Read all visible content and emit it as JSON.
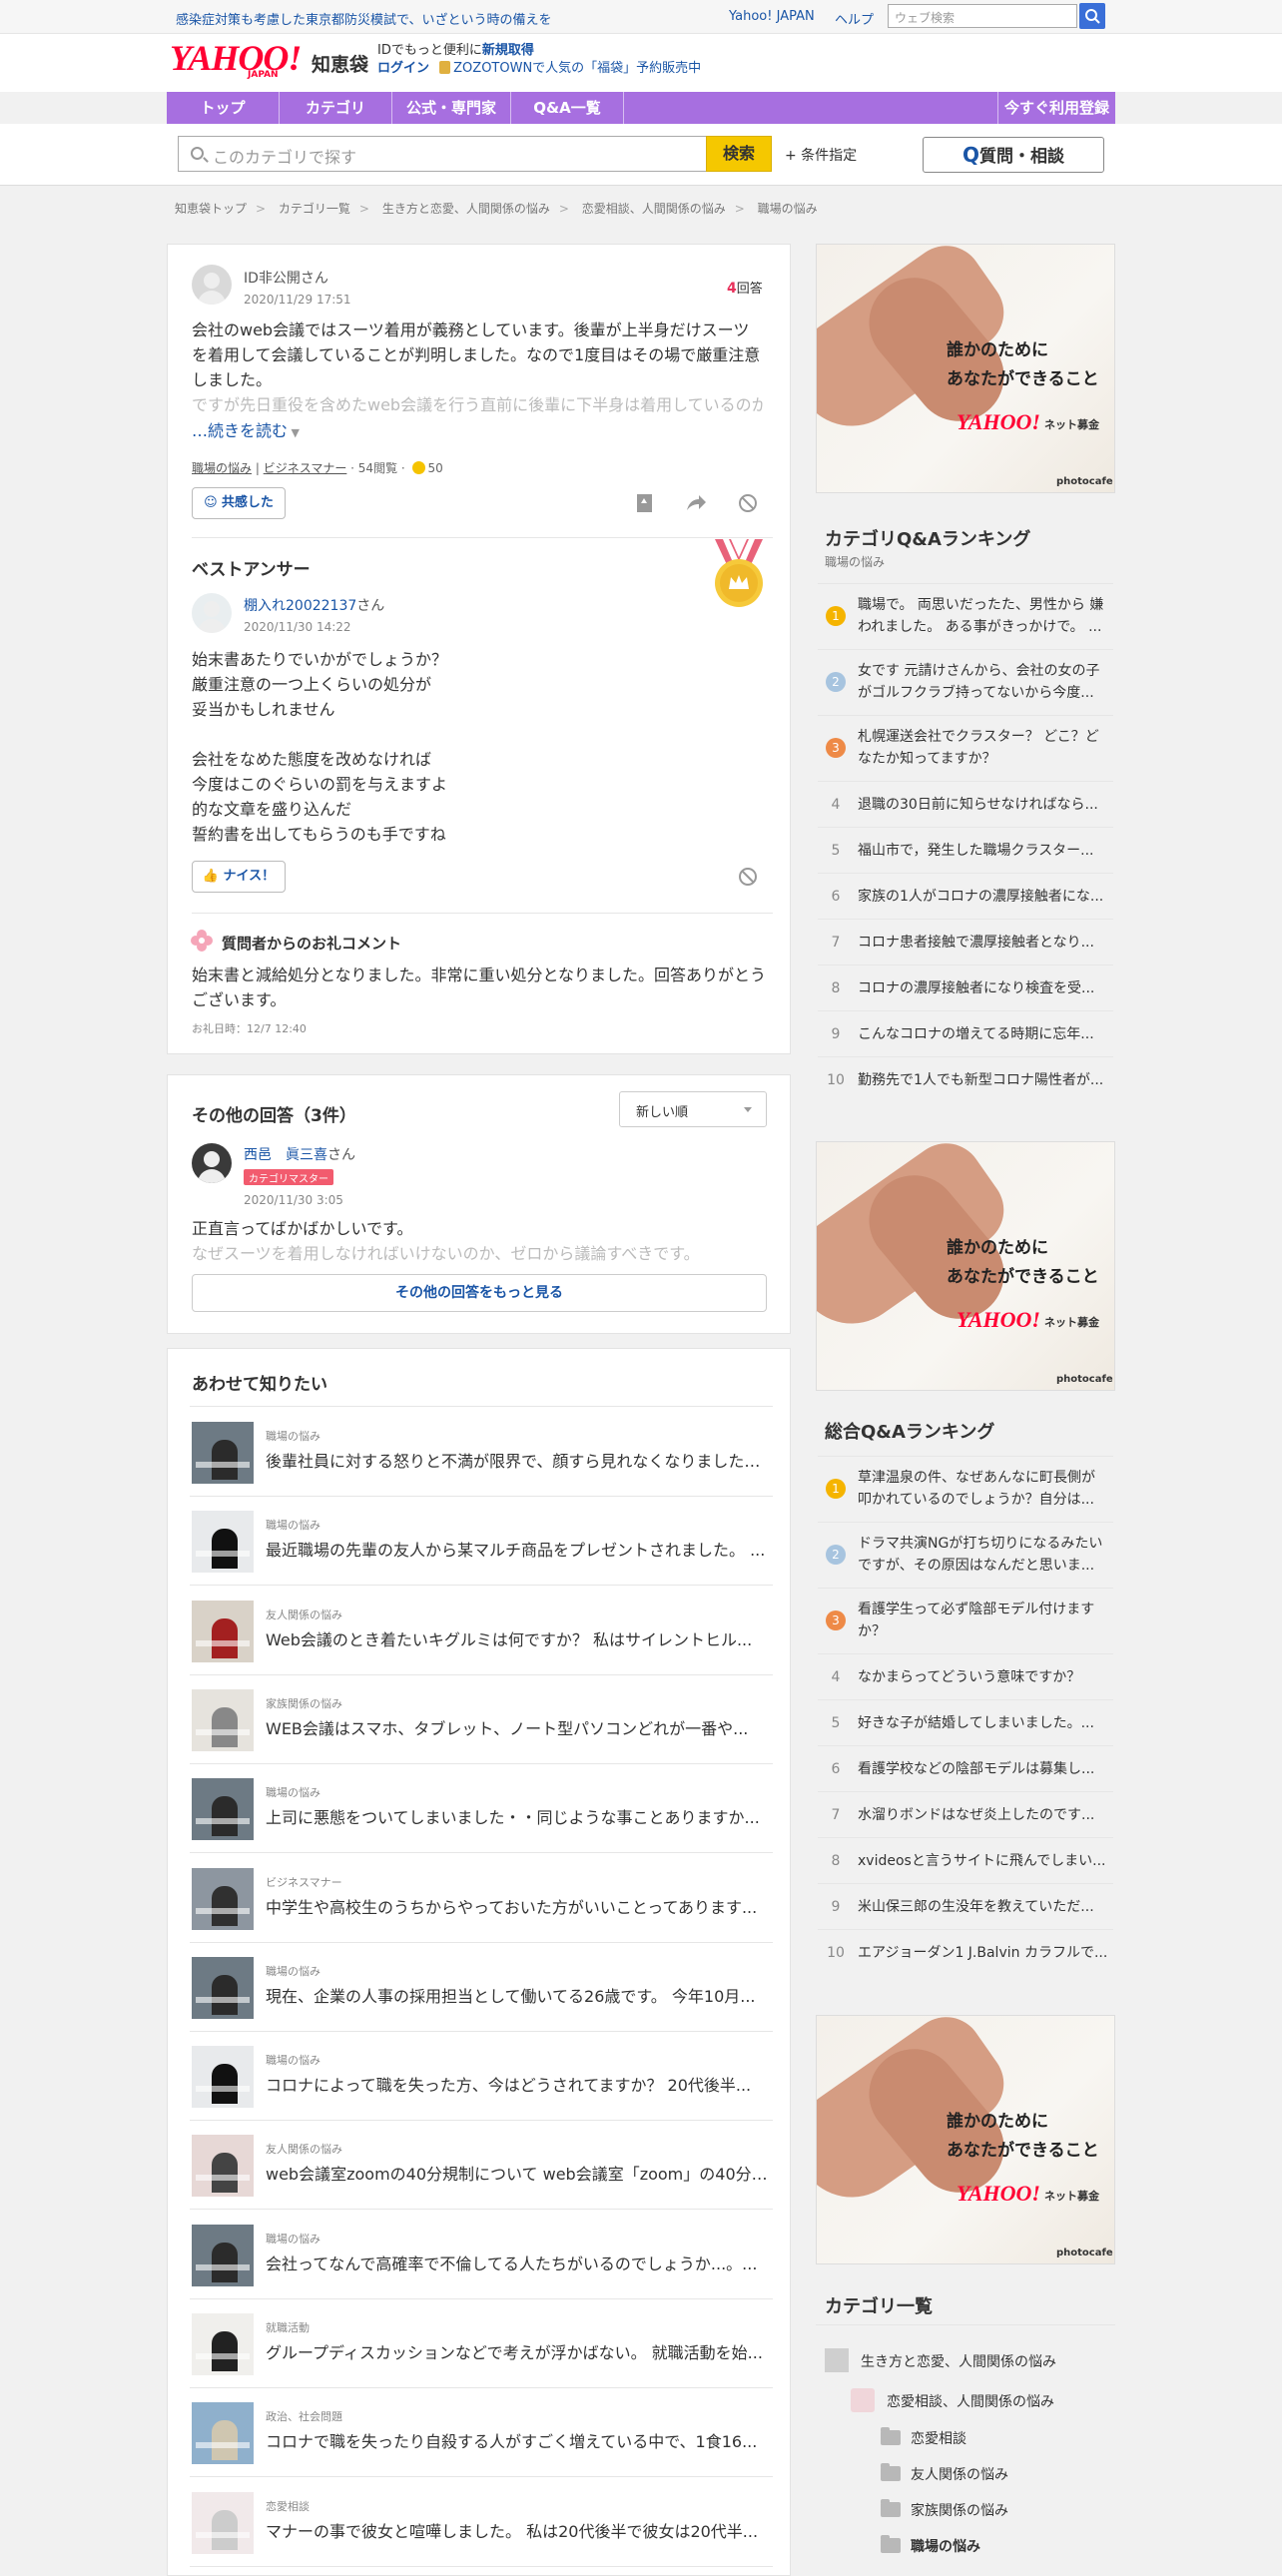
{
  "topbar": {
    "notice": "感染症対策も考慮した東京都防災模試で、いざという時の備えを",
    "yahoo_link": "Yahoo! JAPAN",
    "help": "ヘルプ",
    "web_search_placeholder": "ウェブ検索"
  },
  "header": {
    "logo": "YAHOO!",
    "logo_sub": "JAPAN",
    "logo_service": "知恵袋",
    "info_line1_prefix": "IDでもっと便利に",
    "info_line1_link": "新規取得",
    "info_login": "ログイン",
    "info_zozo": "ZOZOTOWNで人気の「福袋」予約販売中"
  },
  "nav": {
    "items": [
      "トップ",
      "カテゴリ",
      "公式・専門家",
      "Q&A一覧"
    ],
    "right": "今すぐ利用登録"
  },
  "search": {
    "placeholder": "このカテゴリで探す",
    "button": "検索",
    "conditions": "+ 条件指定",
    "ask_button": "質問・相談"
  },
  "breadcrumbs": [
    "知恵袋トップ",
    "カテゴリ一覧",
    "生き方と恋愛、人間関係の悩み",
    "恋愛相談、人間関係の悩み",
    "職場の悩み"
  ],
  "question": {
    "user": "ID非公開",
    "user_suffix": "さん",
    "date": "2020/11/29 17:51",
    "answer_count": "4",
    "answer_label": "回答",
    "text": "会社のweb会議ではスーツ着用が義務としています。後輩が上半身だけスーツを着用して会議していることが判明しました。なので1度目はその場で厳重注意しました。",
    "text_faded": "ですが先日重役を含めたweb会議を行う直前に後輩に下半身は着用しているのか",
    "read_more": "…続きを読む",
    "tag1": "職場の悩み",
    "tag2": "ビジネスマナー",
    "views": "54閲覧",
    "coins": "50",
    "empathy_button": "共感した"
  },
  "best_answer": {
    "heading": "ベストアンサー",
    "user": "棚入れ20022137",
    "user_suffix": "さん",
    "date": "2020/11/30 14:22",
    "text": "始末書あたりでいかがでしょうか？\n厳重注意の一つ上くらいの処分が\n妥当かもしれません\n\n会社をなめた態度を改めなければ\n今度はこのぐらいの罰を与えますよ\n的な文章を盛り込んだ\n誓約書を出してもらうのも手ですね",
    "nice_button": "ナイス！"
  },
  "thanks": {
    "heading": "質問者からのお礼コメント",
    "text": "始末書と減給処分となりました。非常に重い処分となりました。回答ありがとうございます。",
    "date": "お礼日時：12/7 12:40"
  },
  "other_answers": {
    "heading": "その他の回答（3件）",
    "sort": "新しい順",
    "user": "西邑　眞三喜",
    "user_suffix": "さん",
    "badge": "カテゴリマスター",
    "date": "2020/11/30 3:05",
    "text": "正直言ってばかばかしいです。",
    "text_faded": "なぜスーツを着用しなければいけないのか、ゼロから議論すべきです。",
    "more_button": "その他の回答をもっと見る"
  },
  "related": {
    "heading": "あわせて知りたい",
    "items": [
      {
        "cat": "職場の悩み",
        "title": "後輩社員に対する怒りと不満が限界で、顔すら見れなくなりました。..."
      },
      {
        "cat": "職場の悩み",
        "title": "最近職場の先輩の友人から某マルチ商品をプレゼントされました。 ..."
      },
      {
        "cat": "友人関係の悩み",
        "title": "Web会議のとき着たいキグルミは何ですか？ 私はサイレントヒル..."
      },
      {
        "cat": "家族関係の悩み",
        "title": "WEB会議はスマホ、タブレット、ノート型パソコンどれが一番や..."
      },
      {
        "cat": "職場の悩み",
        "title": "上司に悪態をついてしまいました・・同じような事ことありますか..."
      },
      {
        "cat": "ビジネスマナー",
        "title": "中学生や高校生のうちからやっておいた方がいいことってあります..."
      },
      {
        "cat": "職場の悩み",
        "title": "現在、企業の人事の採用担当として働いてる26歳です。 今年10月..."
      },
      {
        "cat": "職場の悩み",
        "title": "コロナによって職を失った方、今はどうされてますか？ 20代後半..."
      },
      {
        "cat": "友人関係の悩み",
        "title": "web会議室zoomの40分規制について web会議室「zoom」の40分規..."
      },
      {
        "cat": "職場の悩み",
        "title": "会社ってなんで高確率で不倫してる人たちがいるのでしょうか...。..."
      },
      {
        "cat": "就職活動",
        "title": "グループディスカッションなどで考えが浮かばない。 就職活動を始..."
      },
      {
        "cat": "政治、社会問題",
        "title": "コロナで職を失ったり自殺する人がすごく増えている中で、1食16..."
      },
      {
        "cat": "恋愛相談",
        "title": "マナーの事で彼女と喧嘩しました。 私は20代後半で彼女は20代半..."
      }
    ]
  },
  "ad": {
    "text": "誰かのために\nあなたができること",
    "brand": "YAHOO!",
    "brand_sub": "ネット募金",
    "credit": "photocafe"
  },
  "category_ranking": {
    "heading": "カテゴリQ&Aランキング",
    "sub": "職場の悩み",
    "items": [
      "職場で。 両思いだったた、男性から 嫌われました。 ある事がきっかけで。 ...",
      "女です 元請けさんから、会社の女の子がゴルフクラブ持ってないから今度...",
      "札幌運送会社でクラスター？ どこ？どなたか知ってますか？",
      "退職の30日前に知らせなければなら...",
      "福山市で，発生した職場クラスター...",
      "家族の1人がコロナの濃厚接触者にな...",
      "コロナ患者接触で濃厚接触者となり...",
      "コロナの濃厚接触者になり検査を受...",
      "こんなコロナの増えてる時期に忘年...",
      "勤務先で1人でも新型コロナ陽性者が..."
    ]
  },
  "overall_ranking": {
    "heading": "総合Q&Aランキング",
    "items": [
      "草津温泉の件、なぜあんなに町長側が叩かれているのでしょうか？自分は...",
      "ドラマ共演NGが打ち切りになるみたいですが、その原因はなんだと思いま...",
      "看護学生って必ず陰部モデル付けますか？",
      "なかまらってどういう意味ですか？",
      "好きな子が結婚してしまいました。...",
      "看護学校などの陰部モデルは募集し...",
      "水溜りボンドはなぜ炎上したのです...",
      "xvideosと言うサイトに飛んでしまい...",
      "米山保三郎の生没年を教えていただ...",
      "エアジョーダン1 J.Balvin カラフルで..."
    ]
  },
  "category_list": {
    "heading": "カテゴリ一覧",
    "level1": "生き方と恋愛、人間関係の悩み",
    "level2": "恋愛相談、人間関係の悩み",
    "level3": [
      "恋愛相談",
      "友人関係の悩み",
      "家族関係の悩み",
      "職場の悩み"
    ]
  },
  "colors": {
    "nav": "#a76fe0",
    "link": "#1a55a6",
    "search_button": "#f5c800",
    "rank1": "#f5b400",
    "rank2": "#a7c4df",
    "rank3": "#ee8a47"
  }
}
